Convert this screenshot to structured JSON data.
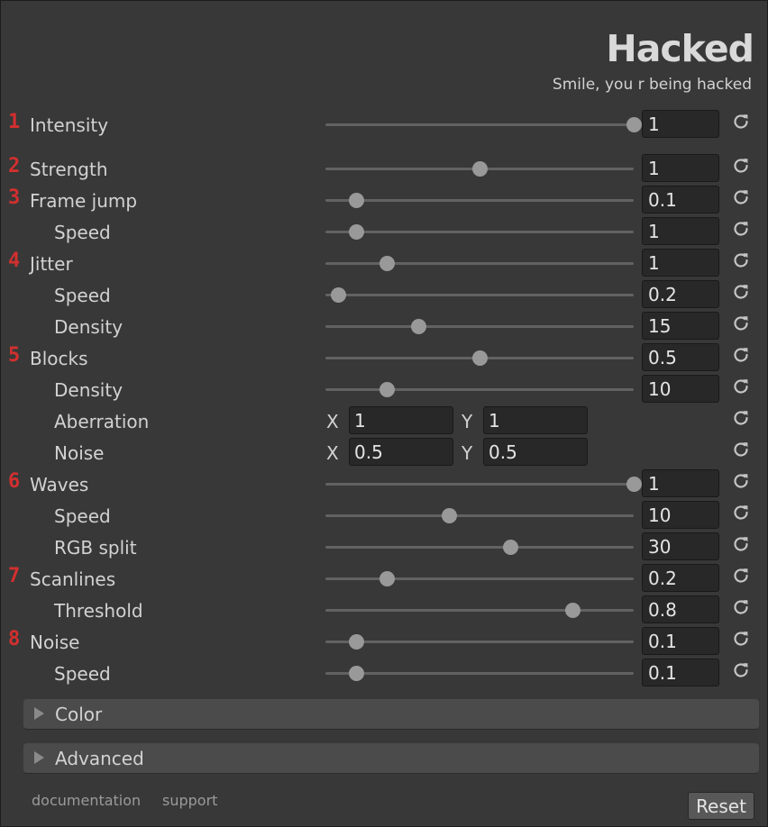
{
  "header": {
    "title": "Hacked",
    "subtitle": "Smile, you r being hacked"
  },
  "rows": [
    {
      "num": "1",
      "label": "Intensity",
      "value": "1",
      "level": 1.0
    },
    {
      "num": "2",
      "label": "Strength",
      "value": "1",
      "level": 0.5
    },
    {
      "num": "3",
      "label": "Frame jump",
      "value": "0.1",
      "level": 0.1
    },
    {
      "num": "",
      "label": "Speed",
      "value": "1",
      "level": 0.1
    },
    {
      "num": "4",
      "label": "Jitter",
      "value": "1",
      "level": 0.2
    },
    {
      "num": "",
      "label": "Speed",
      "value": "0.2",
      "level": 0.04
    },
    {
      "num": "",
      "label": "Density",
      "value": "15",
      "level": 0.3
    },
    {
      "num": "5",
      "label": "Blocks",
      "value": "0.5",
      "level": 0.5
    },
    {
      "num": "",
      "label": "Density",
      "value": "10",
      "level": 0.2
    },
    {
      "num": "",
      "label": "Aberration",
      "vector": {
        "x_label": "X",
        "x": "1",
        "y_label": "Y",
        "y": "1"
      }
    },
    {
      "num": "",
      "label": "Noise",
      "vector": {
        "x_label": "X",
        "x": "0.5",
        "y_label": "Y",
        "y": "0.5"
      }
    },
    {
      "num": "6",
      "label": "Waves",
      "value": "1",
      "level": 1.0
    },
    {
      "num": "",
      "label": "Speed",
      "value": "10",
      "level": 0.4
    },
    {
      "num": "",
      "label": "RGB split",
      "value": "30",
      "level": 0.6
    },
    {
      "num": "7",
      "label": "Scanlines",
      "value": "0.2",
      "level": 0.2
    },
    {
      "num": "",
      "label": "Threshold",
      "value": "0.8",
      "level": 0.8
    },
    {
      "num": "8",
      "label": "Noise",
      "value": "0.1",
      "level": 0.1
    },
    {
      "num": "",
      "label": "Speed",
      "value": "0.1",
      "level": 0.1
    }
  ],
  "foldouts": {
    "color": "Color",
    "advanced": "Advanced"
  },
  "footer": {
    "documentation": "documentation",
    "support": "support",
    "reset": "Reset"
  },
  "icons": {
    "reset": "reset-icon",
    "foldout": "triangle-right-icon"
  }
}
